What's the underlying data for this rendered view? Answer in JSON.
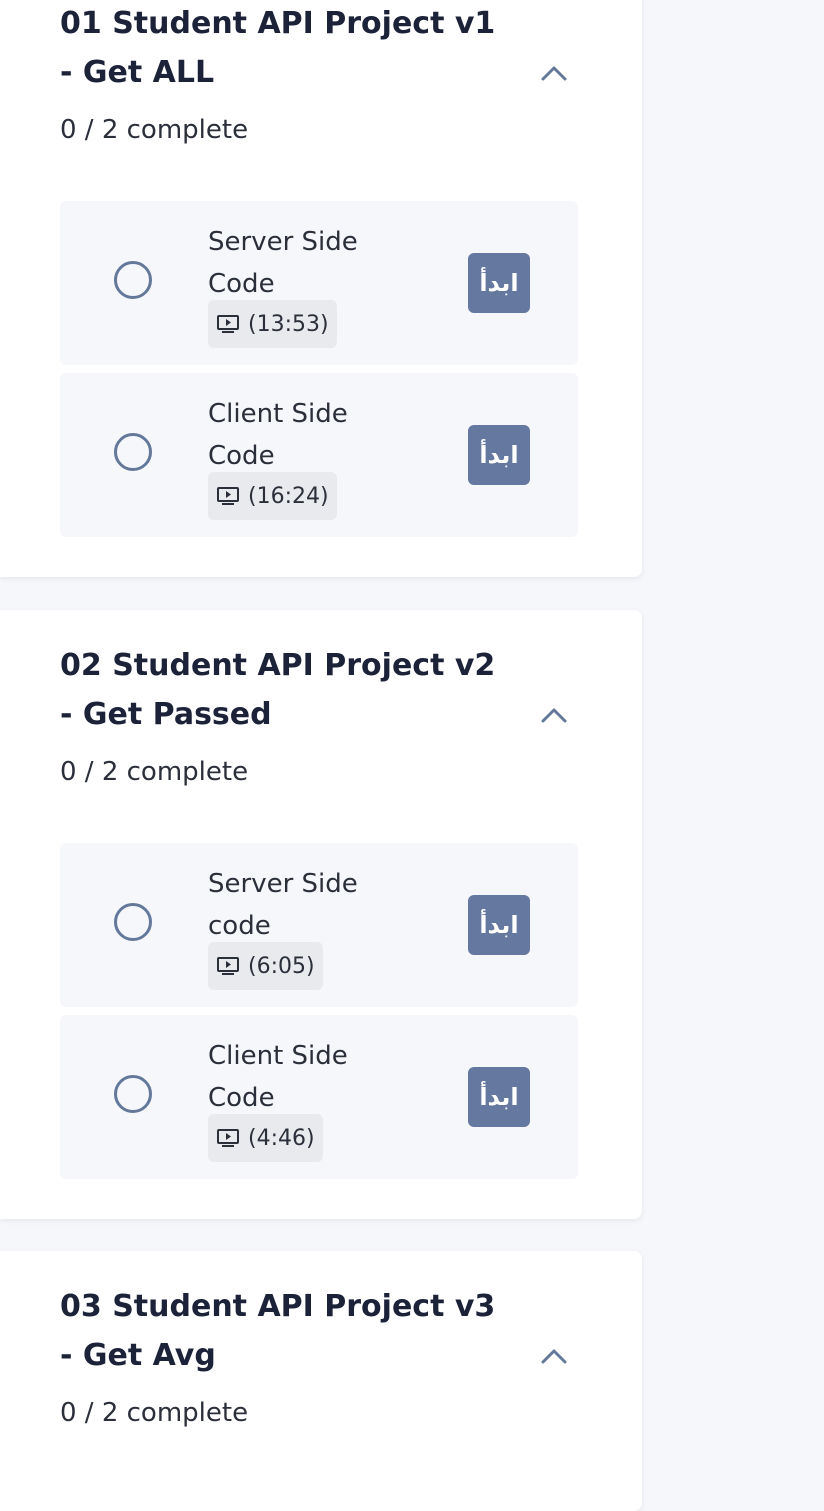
{
  "sections": [
    {
      "title_line1": "01 Student API Project v1",
      "title_line2": "- Get ALL",
      "progress": "0 / 2 complete",
      "lessons": [
        {
          "title_line1": "Server Side",
          "title_line2": "Code",
          "duration": "(13:53)",
          "button": "ابدأ"
        },
        {
          "title_line1": "Client Side",
          "title_line2": "Code",
          "duration": "(16:24)",
          "button": "ابدأ"
        }
      ]
    },
    {
      "title_line1": "02 Student API Project v2",
      "title_line2": "- Get Passed",
      "progress": "0 / 2 complete",
      "lessons": [
        {
          "title_line1": "Server Side",
          "title_line2": "code",
          "duration": "(6:05)",
          "button": "ابدأ"
        },
        {
          "title_line1": "Client Side",
          "title_line2": "Code",
          "duration": "(4:46)",
          "button": "ابدأ"
        }
      ]
    },
    {
      "title_line1": "03 Student API Project v3",
      "title_line2": "- Get Avg",
      "progress": "0 / 2 complete",
      "lessons": []
    }
  ],
  "icons": {
    "expand": "chevron-up-icon",
    "video": "video-play-icon",
    "status": "circle-outline-icon"
  },
  "colors": {
    "accent": "#65789f",
    "lesson_bg": "#f6f7fb",
    "page_bg": "#f6f7fb",
    "radio": "#64789a"
  }
}
